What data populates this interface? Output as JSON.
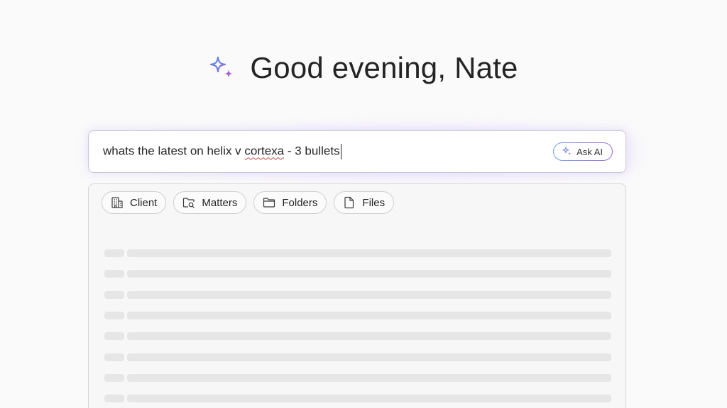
{
  "greeting": {
    "text": "Good evening, Nate",
    "icon": "sparkle-icon"
  },
  "search": {
    "query_before": "whats the latest on helix v ",
    "query_squiggle": "cortexa",
    "query_after": " - 3 bullets",
    "ask_ai_label": "Ask AI",
    "ask_ai_icon": "sparkle-icon"
  },
  "filters": {
    "chips": [
      {
        "label": "Client",
        "icon": "building-icon"
      },
      {
        "label": "Matters",
        "icon": "folder-search-icon"
      },
      {
        "label": "Folders",
        "icon": "folder-icon"
      },
      {
        "label": "Files",
        "icon": "document-icon"
      }
    ]
  },
  "results": {
    "state": "loading",
    "skeleton_rows": 8
  },
  "colors": {
    "sparkle_blue": "#5b8fe0",
    "sparkle_purple": "#a65bd6",
    "text": "#242424",
    "panel_bg": "#f7f7f7",
    "skeleton": "#e6e6e6"
  }
}
